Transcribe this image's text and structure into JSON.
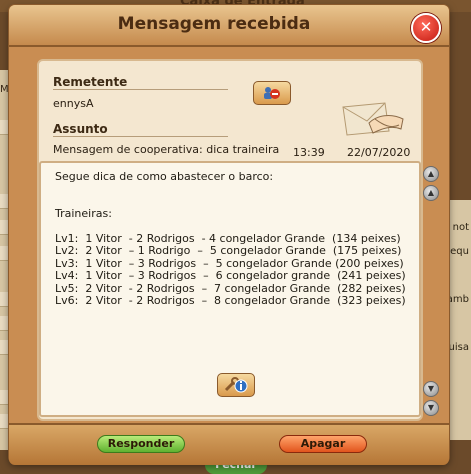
{
  "background": {
    "title_fragment": "Caixa de Entrada",
    "left_fragment": "Mo",
    "right_fragments": [
      "not",
      "equ",
      "amb",
      "uisa"
    ],
    "close_button_label": "Fechar"
  },
  "dialog": {
    "title": "Mensagem recebida",
    "close_icon": "close-icon"
  },
  "message": {
    "sender_label": "Remetente",
    "sender": "ennysA",
    "subject_label": "Assunto",
    "subject": "Mensagem de cooperativa: dica traineira",
    "time": "13:39",
    "date": "22/07/2020",
    "body_lines": [
      "Segue dica de como abastecer o barco:",
      "",
      "",
      "Traineiras:",
      "",
      "Lv1:  1 Vitor  - 2 Rodrigos  - 4 congelador Grande  (134 peixes)",
      "Lv2:  2 Vitor  – 1 Rodrigo  –  5 congelador Grande  (175 peixes)",
      "Lv3:  1 Vitor  – 3 Rodrigos  –  5 congelador Grande (200 peixes)",
      "Lv4:  1 Vitor  – 3 Rodrigos  –  6 congelador grande  (241 peixes)",
      "Lv5:  2 Vitor  - 2 Rodrigos  –  7 congelador Grande  (282 peixes)",
      "Lv6:  2 Vitor  - 2 Rodrigos  –  8 congelador Grande  (323 peixes)"
    ]
  },
  "actions": {
    "reply_label": "Responder",
    "delete_label": "Apagar"
  },
  "colors": {
    "reply": "#5fb130",
    "delete": "#e2551d",
    "close": "#c4180f"
  }
}
